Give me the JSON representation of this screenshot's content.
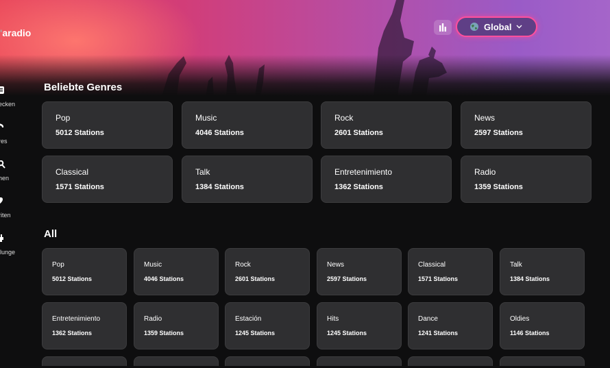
{
  "app": {
    "logo_text": "aradio"
  },
  "header": {
    "region_button_label": "Global"
  },
  "sidebar": {
    "items": [
      {
        "label": "ecken",
        "icon": "compass-icon"
      },
      {
        "label": "res",
        "icon": "genres-icon"
      },
      {
        "label": "hen",
        "icon": "search-icon"
      },
      {
        "label": "riten",
        "icon": "heart-icon"
      },
      {
        "label": "llunge",
        "icon": "settings-icon"
      }
    ]
  },
  "popular": {
    "title": "Beliebte Genres",
    "genres": [
      {
        "name": "Pop",
        "count": "5012 Stations"
      },
      {
        "name": "Music",
        "count": "4046 Stations"
      },
      {
        "name": "Rock",
        "count": "2601 Stations"
      },
      {
        "name": "News",
        "count": "2597 Stations"
      },
      {
        "name": "Classical",
        "count": "1571 Stations"
      },
      {
        "name": "Talk",
        "count": "1384 Stations"
      },
      {
        "name": "Entretenimiento",
        "count": "1362 Stations"
      },
      {
        "name": "Radio",
        "count": "1359 Stations"
      }
    ]
  },
  "all": {
    "title": "All",
    "genres": [
      {
        "name": "Pop",
        "count": "5012 Stations"
      },
      {
        "name": "Music",
        "count": "4046 Stations"
      },
      {
        "name": "Rock",
        "count": "2601 Stations"
      },
      {
        "name": "News",
        "count": "2597 Stations"
      },
      {
        "name": "Classical",
        "count": "1571 Stations"
      },
      {
        "name": "Talk",
        "count": "1384 Stations"
      },
      {
        "name": "Entretenimiento",
        "count": "1362 Stations"
      },
      {
        "name": "Radio",
        "count": "1359 Stations"
      },
      {
        "name": "Estación",
        "count": "1245 Stations"
      },
      {
        "name": "Hits",
        "count": "1245 Stations"
      },
      {
        "name": "Dance",
        "count": "1241 Stations"
      },
      {
        "name": "Oldies",
        "count": "1146 Stations"
      }
    ]
  },
  "colors": {
    "background": "#0e0e0f",
    "card": "#2f2f31",
    "accent_pink": "#ff4f9d",
    "region_button": "#5f3f86"
  }
}
